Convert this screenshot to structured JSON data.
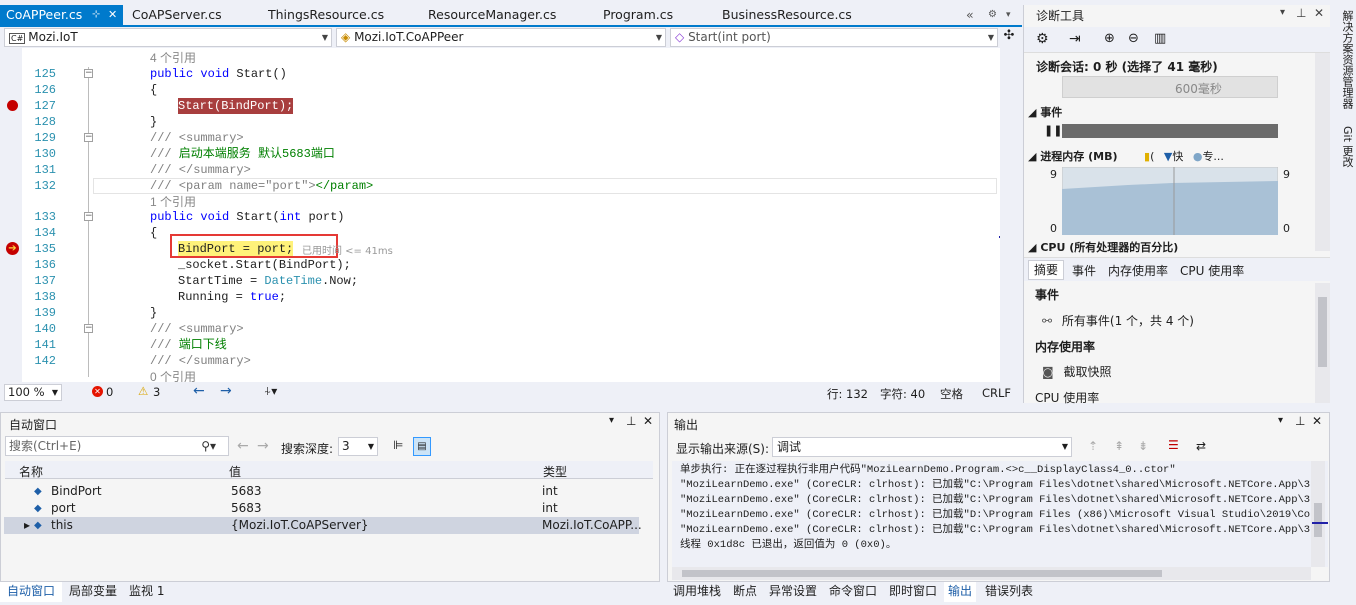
{
  "tabs": [
    {
      "label": "CoAPPeer.cs"
    },
    {
      "label": "CoAPServer.cs"
    },
    {
      "label": "ThingsResource.cs"
    },
    {
      "label": "ResourceManager.cs"
    },
    {
      "label": "Program.cs"
    },
    {
      "label": "BusinessResource.cs"
    }
  ],
  "nav": {
    "project": "Mozi.IoT",
    "class": "Mozi.IoT.CoAPPeer",
    "member": "Start(int port)"
  },
  "code_lines": [
    {
      "ln": "",
      "text": "4 个引用",
      "kind": "ref"
    },
    {
      "ln": "125",
      "text": "public void Start()",
      "kind": "code"
    },
    {
      "ln": "126",
      "text": "{",
      "kind": "code"
    },
    {
      "ln": "127",
      "text": "Start(BindPort);",
      "kind": "code"
    },
    {
      "ln": "128",
      "text": "}",
      "kind": "code"
    },
    {
      "ln": "129",
      "text": "/// <summary>",
      "kind": "comment"
    },
    {
      "ln": "130",
      "text": "/// 启动本端服务 默认5683端口",
      "kind": "comment"
    },
    {
      "ln": "131",
      "text": "/// </summary>",
      "kind": "comment"
    },
    {
      "ln": "132",
      "text": "/// <param name=\"port\"></param>",
      "kind": "comment"
    },
    {
      "ln": "",
      "text": "1 个引用",
      "kind": "ref"
    },
    {
      "ln": "133",
      "text": "public void Start(int port)",
      "kind": "code"
    },
    {
      "ln": "134",
      "text": "{",
      "kind": "code"
    },
    {
      "ln": "135",
      "text": "BindPort = port;",
      "kind": "code"
    },
    {
      "ln": "136",
      "text": "_socket.Start(BindPort);",
      "kind": "code"
    },
    {
      "ln": "137",
      "text": "StartTime = DateTime.Now;",
      "kind": "code"
    },
    {
      "ln": "138",
      "text": "Running = true;",
      "kind": "code"
    },
    {
      "ln": "139",
      "text": "}",
      "kind": "code"
    },
    {
      "ln": "140",
      "text": "/// <summary>",
      "kind": "comment"
    },
    {
      "ln": "141",
      "text": "/// 端口下线",
      "kind": "comment"
    },
    {
      "ln": "142",
      "text": "/// </summary>",
      "kind": "comment"
    },
    {
      "ln": "",
      "text": "0 个引用",
      "kind": "ref"
    }
  ],
  "elapsed_hint": "已用时间 <= 41ms",
  "status": {
    "zoom": "100 %",
    "errors": "0",
    "warnings": "3",
    "line": "行: 132",
    "col": "字符: 40",
    "spaces": "空格",
    "eol": "CRLF"
  },
  "autos": {
    "title": "自动窗口",
    "search_placeholder": "搜索(Ctrl+E)",
    "depth_label": "搜索深度:",
    "depth_value": "3",
    "columns": [
      "名称",
      "值",
      "类型"
    ],
    "rows": [
      {
        "name": "BindPort",
        "value": "5683",
        "type": "int"
      },
      {
        "name": "port",
        "value": "5683",
        "type": "int"
      },
      {
        "name": "this",
        "value": "{Mozi.IoT.CoAPServer}",
        "type": "Mozi.IoT.CoAPP..."
      }
    ],
    "bottom_tabs": [
      "自动窗口",
      "局部变量",
      "监视 1"
    ]
  },
  "output": {
    "title": "输出",
    "source_label": "显示输出来源(S):",
    "source_value": "调试",
    "lines": [
      "单步执行: 正在逐过程执行非用户代码\"MoziLearnDemo.Program.<>c__DisplayClass4_0..ctor\"",
      "\"MoziLearnDemo.exe\" (CoreCLR: clrhost): 已加载\"C:\\Program Files\\dotnet\\shared\\Microsoft.NETCore.App\\3.1",
      "\"MoziLearnDemo.exe\" (CoreCLR: clrhost): 已加载\"C:\\Program Files\\dotnet\\shared\\Microsoft.NETCore.App\\3.1",
      "\"MoziLearnDemo.exe\" (CoreCLR: clrhost): 已加载\"D:\\Program Files (x86)\\Microsoft Visual Studio\\2019\\Comm",
      "\"MoziLearnDemo.exe\" (CoreCLR: clrhost): 已加载\"C:\\Program Files\\dotnet\\shared\\Microsoft.NETCore.App\\3.1",
      "线程 0x1d8c 已退出，返回值为 0 (0x0)。"
    ],
    "bottom_tabs": [
      "调用堆栈",
      "断点",
      "异常设置",
      "命令窗口",
      "即时窗口",
      "输出",
      "错误列表"
    ]
  },
  "diag": {
    "title": "诊断工具",
    "session": "诊断会话: 0 秒 (选择了 41 毫秒)",
    "timeline_label": "600毫秒",
    "events_label": "事件",
    "memory_label": "进程内存 (MB)",
    "legend": [
      "(",
      "快",
      "专..."
    ],
    "mem_max": "9",
    "mem_min": "0",
    "cpu_label": "CPU (所有处理器的百分比)",
    "tabs": [
      "摘要",
      "事件",
      "内存使用率",
      "CPU 使用率"
    ],
    "sec_events": "事件",
    "all_events": "所有事件(1 个，共 4 个)",
    "sec_memory": "内存使用率",
    "snapshot": "截取快照",
    "sec_cpu": "CPU 使用率"
  },
  "side_tabs": [
    "解决方案资源管理器",
    "Git 更改"
  ],
  "colors": {
    "accent": "#007acc",
    "breakpoint": "#c50000",
    "highlight": "#e53935"
  }
}
